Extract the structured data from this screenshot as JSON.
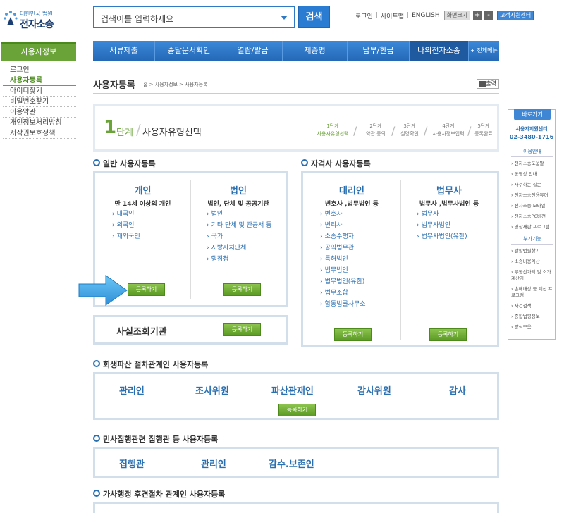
{
  "header": {
    "logo_line1": "대한민국 법원",
    "logo_line2": "전자소송",
    "search_placeholder": "검색어를 입력하세요",
    "search_button": "검색",
    "util_login": "로그인",
    "util_sitemap": "사이트맵",
    "util_english": "ENGLISH",
    "util_zoom": "화면크기",
    "util_plus": "+",
    "util_minus": "-",
    "util_center": "고객지원센터"
  },
  "lnb": {
    "title": "사용자정보",
    "items": [
      "로그인",
      "사용자등록",
      "아이디찾기",
      "비밀번호찾기",
      "이용약관",
      "개인정보처리방침",
      "저작권보호정책"
    ]
  },
  "gnb": {
    "items": [
      "서류제출",
      "송달문서확인",
      "열람/발급",
      "제증명",
      "납부/환급",
      "나의전자소송"
    ],
    "all_menu": "+ 전체메뉴보기"
  },
  "page": {
    "title": "사용자등록",
    "breadcrumb": "홈 > 사용자정보 > 사용자등록",
    "print": "출력"
  },
  "step": {
    "num": "1",
    "unit": "단계",
    "name": "사용자유형선택",
    "steps": [
      {
        "label": "1단계",
        "desc": "사용자유형선택"
      },
      {
        "label": "2단계",
        "desc": "약관 동의"
      },
      {
        "label": "3단계",
        "desc": "실명확인"
      },
      {
        "label": "4단계",
        "desc": "사용자정보입력"
      },
      {
        "label": "5단계",
        "desc": "등록완료"
      }
    ]
  },
  "general": {
    "header": "일반 사용자등록",
    "personal": {
      "title": "개인",
      "sub": "만 14세 이상의 개인",
      "items": [
        "내국인",
        "외국인",
        "재외국민"
      ]
    },
    "corporate": {
      "title": "법인",
      "sub": "법인, 단체 및 공공기관",
      "items": [
        "법인",
        "기타 단체 및 관공서 등",
        "국가",
        "지방자치단체",
        "행정청"
      ]
    },
    "register": "등록하기"
  },
  "fact": {
    "title": "사실조회기관",
    "register": "등록하기"
  },
  "qualified": {
    "header": "자격사 사용자등록",
    "agent": {
      "title": "대리인",
      "sub": "변호사 ,법무법인 등",
      "items": [
        "변호사",
        "변리사",
        "소송수행자",
        "공익법무관",
        "특허법인",
        "법무법인",
        "법무법인(유한)",
        "법무조합",
        "합동법률사무소"
      ]
    },
    "scrivener": {
      "title": "법무사",
      "sub": "법무사 ,법무사법인 등",
      "items": [
        "법무사",
        "법무사법인",
        "법무사법인(유한)"
      ]
    },
    "register": "등록하기"
  },
  "rehab": {
    "header": "회생파산 절차관계인 사용자등록",
    "items": [
      "관리인",
      "조사위원",
      "파산관재인",
      "감사위원",
      "감사"
    ],
    "register": "등록하기"
  },
  "civil": {
    "header": "민사집행관련 집행관 등 사용자등록",
    "items": [
      "집행관",
      "관리인",
      "감수.보존인"
    ]
  },
  "family": {
    "header": "가사행정 후견절차 관계인 사용자등록"
  },
  "quick": {
    "title": "바로가기",
    "center_name": "사용자지원센터",
    "center_phone": "02-3480-1716",
    "usage_header": "이용안내",
    "usage_items": [
      "전자소송도움말",
      "동영상 안내",
      "자주하는 질문",
      "전자소송전용뷰어",
      "전자소송 모바일",
      "전자소송PC버전",
      "영상재판 프로그램"
    ],
    "extra_header": "부가기능",
    "extra_items": [
      "관할법원찾기",
      "소송비용계산",
      "부동산가액 및 소가계산기",
      "손해배상 등 계산 프로그램",
      "사건검색",
      "종합법령정보",
      "양식모음"
    ]
  }
}
